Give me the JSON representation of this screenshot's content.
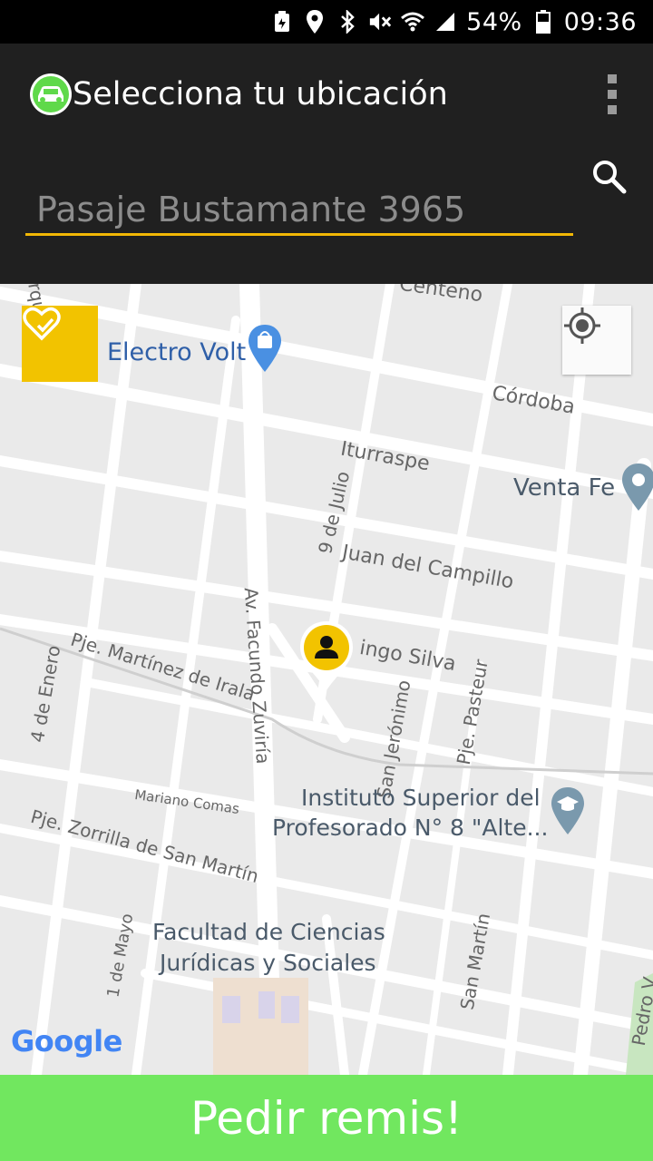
{
  "status_bar": {
    "battery_percent": "54%",
    "time": "09:36",
    "icons": [
      "battery-saver-icon",
      "location-icon",
      "bluetooth-icon",
      "mute-icon",
      "wifi-icon",
      "signal-icon",
      "battery-icon"
    ]
  },
  "app_bar": {
    "title": "Selecciona tu ubicación",
    "logo_icon": "car-logo-icon",
    "menu_icon": "overflow-menu-icon"
  },
  "search": {
    "placeholder": "Pasaje Bustamante 3965",
    "value": "",
    "icon": "search-icon",
    "accent_color": "#f2b705"
  },
  "map": {
    "favorites_icon": "heart-check-icon",
    "locate_icon": "my-location-icon",
    "marker_icon": "user-pin-icon",
    "pois": [
      {
        "name": "Electro Volt"
      },
      {
        "name": "Venta Fe"
      },
      {
        "name": "Instituto Superior del",
        "name2": "Profesorado N° 8 \"Alte..."
      },
      {
        "name": "Facultad de Ciencias",
        "name2": "Jurídicas y Sociales"
      }
    ],
    "streets": {
      "centeno": "Centeno",
      "cordoba": "Córdoba",
      "iturraspe": "Iturraspe",
      "nueve_julio": "9 de Julio",
      "juan_campillo": "Juan del Campillo",
      "domingo_silva": "ingo Silva",
      "martinez_irala": "Pje. Martínez de Irala",
      "facundo_zuviria": "Av. Facundo Zuviría",
      "cuatro_enero": "4 de Enero",
      "san_jeronimo": "San Jerónimo",
      "pasteur": "Pje. Pasteur",
      "mariano_comas": "Mariano Comas",
      "zorrilla": "Pje. Zorrilla de San Martín",
      "uno_mayo": "1 de Mayo",
      "san_martin": "San Martín",
      "pedro": "Pedro V",
      "urquiza": "Urquiza"
    },
    "attribution": "Google"
  },
  "footer": {
    "order_button": "Pedir remis!",
    "color": "#71e75f"
  }
}
